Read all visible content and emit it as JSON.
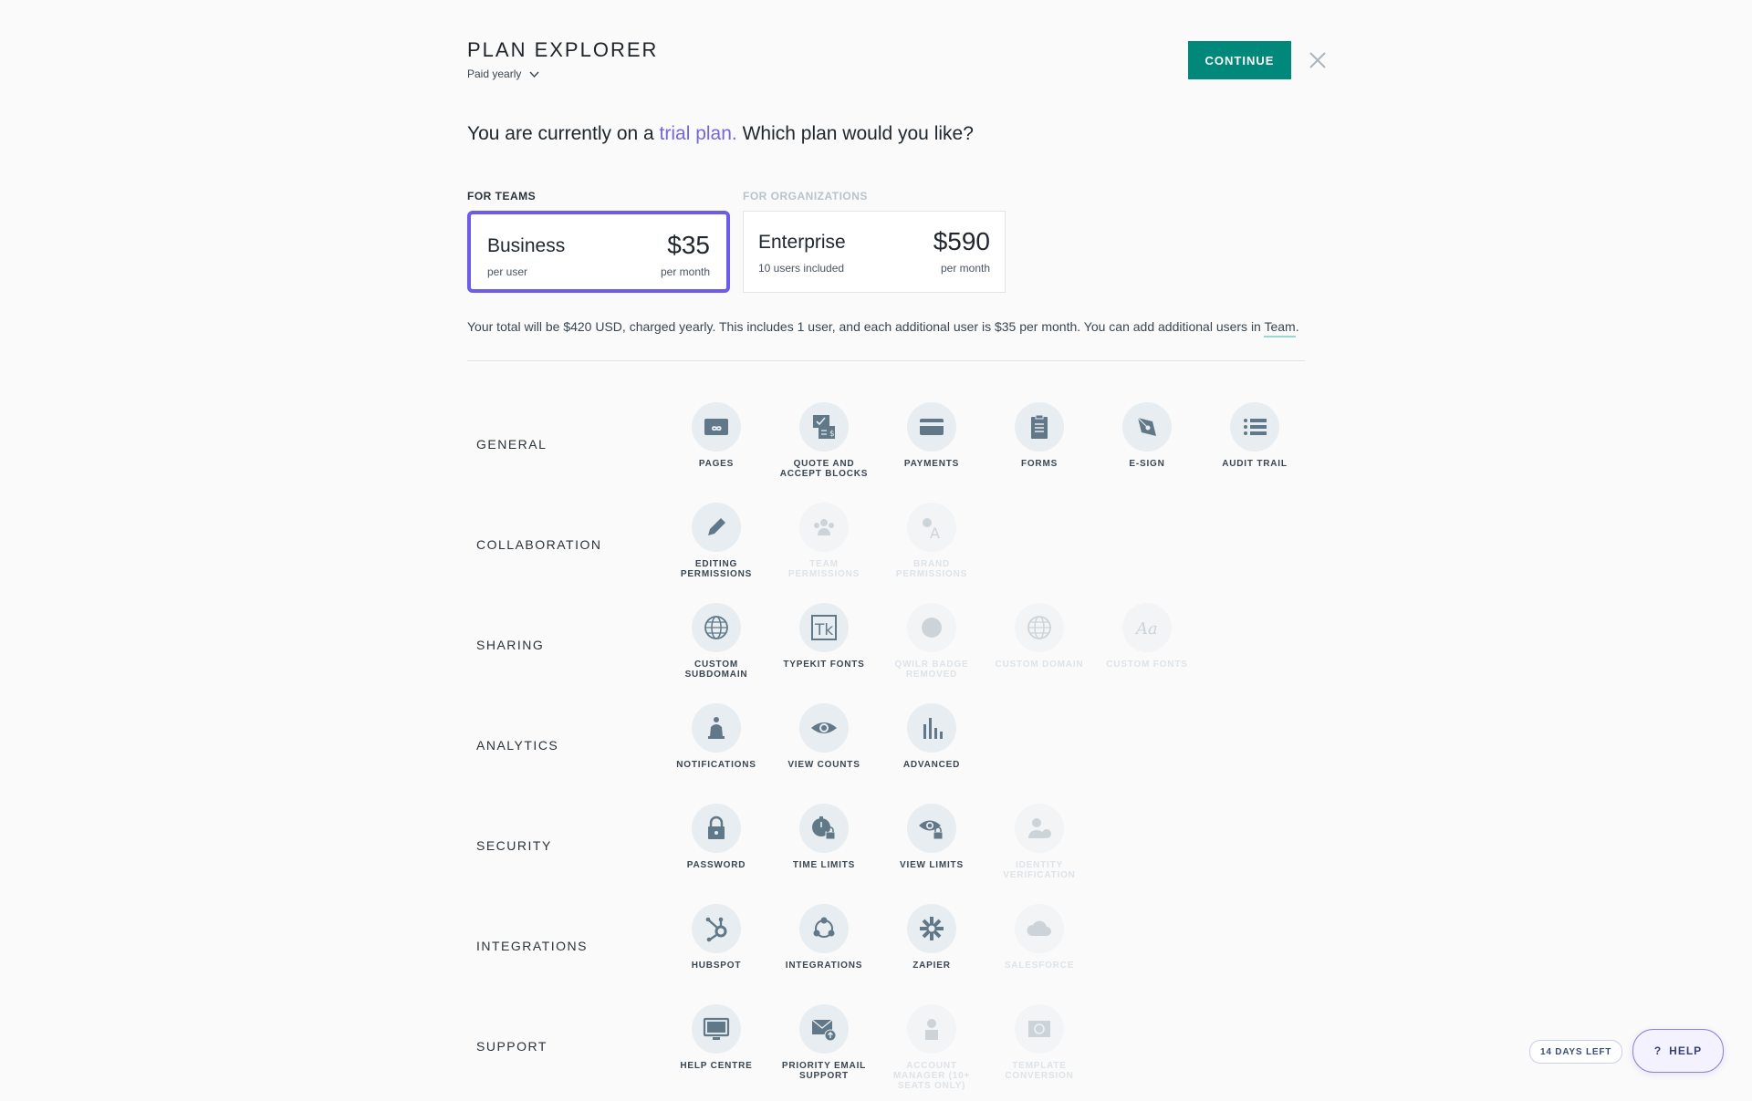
{
  "header": {
    "title": "PLAN EXPLORER",
    "billing_cycle": "Paid yearly",
    "continue_label": "CONTINUE"
  },
  "intro": {
    "prefix": "You are currently on a ",
    "link": "trial plan.",
    "suffix": " Which plan would you like?"
  },
  "plan_groups": {
    "teams": "FOR TEAMS",
    "organizations": "FOR ORGANIZATIONS"
  },
  "plans": [
    {
      "name": "Business",
      "price": "$35",
      "sub_left": "per user",
      "sub_right": "per month",
      "selected": true
    },
    {
      "name": "Enterprise",
      "price": "$590",
      "sub_left": "10 users included",
      "sub_right": "per month",
      "selected": false
    }
  ],
  "total": {
    "text": "Your total will be $420 USD, charged yearly. This includes 1 user, and each additional user is $35 per month. You can add additional users in ",
    "link": "Team",
    "end": "."
  },
  "feature_groups": [
    {
      "category": "GENERAL",
      "features": [
        {
          "label": "PAGES",
          "icon": "infinity-card-icon",
          "enabled": true
        },
        {
          "label": "QUOTE AND ACCEPT BLOCKS",
          "icon": "quote-icon",
          "enabled": true
        },
        {
          "label": "PAYMENTS",
          "icon": "credit-card-icon",
          "enabled": true
        },
        {
          "label": "FORMS",
          "icon": "clipboard-icon",
          "enabled": true
        },
        {
          "label": "E-SIGN",
          "icon": "pen-nib-icon",
          "enabled": true
        },
        {
          "label": "AUDIT TRAIL",
          "icon": "list-icon",
          "enabled": true
        }
      ]
    },
    {
      "category": "COLLABORATION",
      "features": [
        {
          "label": "EDITING PERMISSIONS",
          "icon": "pencil-icon",
          "enabled": true
        },
        {
          "label": "TEAM PERMISSIONS",
          "icon": "team-icon",
          "enabled": false
        },
        {
          "label": "BRAND PERMISSIONS",
          "icon": "brand-icon",
          "enabled": false
        }
      ]
    },
    {
      "category": "SHARING",
      "features": [
        {
          "label": "CUSTOM SUBDOMAIN",
          "icon": "globe-icon",
          "enabled": true
        },
        {
          "label": "TYPEKIT FONTS",
          "icon": "typekit-icon",
          "enabled": true
        },
        {
          "label": "QWILR BADGE REMOVED",
          "icon": "badge-icon",
          "enabled": false
        },
        {
          "label": "CUSTOM DOMAIN",
          "icon": "globe-icon",
          "enabled": false
        },
        {
          "label": "CUSTOM FONTS",
          "icon": "font-icon",
          "enabled": false
        }
      ]
    },
    {
      "category": "ANALYTICS",
      "features": [
        {
          "label": "NOTIFICATIONS",
          "icon": "bell-icon",
          "enabled": true
        },
        {
          "label": "VIEW COUNTS",
          "icon": "eye-icon",
          "enabled": true
        },
        {
          "label": "ADVANCED",
          "icon": "bar-chart-icon",
          "enabled": true
        }
      ]
    },
    {
      "category": "SECURITY",
      "features": [
        {
          "label": "PASSWORD",
          "icon": "lock-icon",
          "enabled": true
        },
        {
          "label": "TIME LIMITS",
          "icon": "timer-lock-icon",
          "enabled": true
        },
        {
          "label": "VIEW LIMITS",
          "icon": "eye-lock-icon",
          "enabled": true
        },
        {
          "label": "IDENTITY VERIFICATION",
          "icon": "identity-icon",
          "enabled": false
        }
      ]
    },
    {
      "category": "INTEGRATIONS",
      "features": [
        {
          "label": "HUBSPOT",
          "icon": "hubspot-icon",
          "enabled": true
        },
        {
          "label": "INTEGRATIONS",
          "icon": "network-icon",
          "enabled": true
        },
        {
          "label": "ZAPIER",
          "icon": "zapier-icon",
          "enabled": true
        },
        {
          "label": "SALESFORCE",
          "icon": "cloud-icon",
          "enabled": false
        }
      ]
    },
    {
      "category": "SUPPORT",
      "features": [
        {
          "label": "HELP CENTRE",
          "icon": "monitor-icon",
          "enabled": true
        },
        {
          "label": "PRIORITY EMAIL SUPPORT",
          "icon": "mail-up-icon",
          "enabled": true
        },
        {
          "label": "ACCOUNT MANAGER (10+ SEATS ONLY)",
          "icon": "person-icon",
          "enabled": false
        },
        {
          "label": "TEMPLATE CONVERSION",
          "icon": "template-icon",
          "enabled": false
        }
      ]
    }
  ],
  "footer": {
    "days_left": "14 DAYS LEFT",
    "help_label": "HELP",
    "help_glyph": "?"
  },
  "colors": {
    "accent": "#00897b",
    "selected_border": "#6c5ce7",
    "link": "#7466e0",
    "icon": "#607887"
  }
}
